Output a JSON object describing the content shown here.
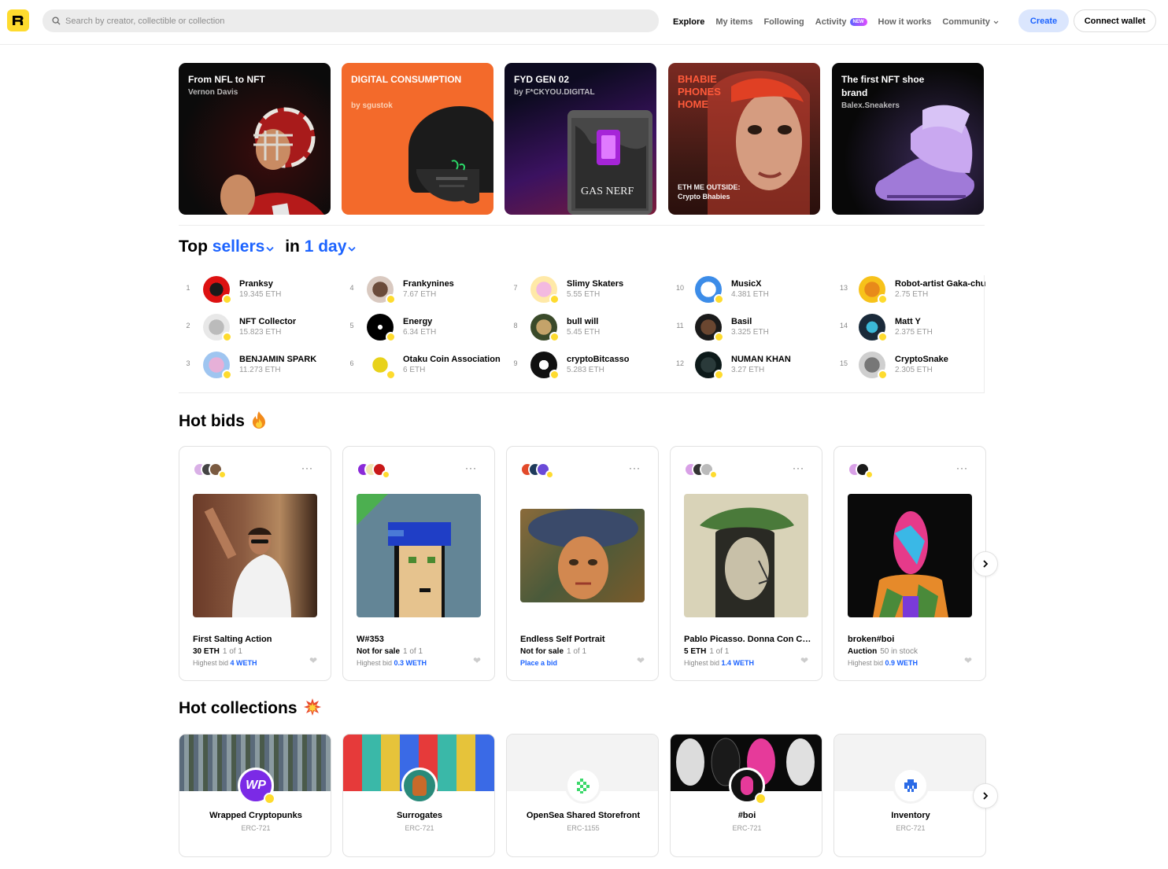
{
  "header": {
    "search_placeholder": "Search by creator, collectible or collection",
    "nav": [
      "Explore",
      "My items",
      "Following",
      "Activity",
      "How it works",
      "Community"
    ],
    "new_badge": "NEW",
    "create_label": "Create",
    "wallet_label": "Connect wallet"
  },
  "promos": [
    {
      "title": "From NFL to NFT",
      "subtitle": "Vernon Davis"
    },
    {
      "title": "DIGITAL CONSUMPTION",
      "subtitle": "by sgustok"
    },
    {
      "title": "FYD GEN 02",
      "subtitle": "by F*CKYOU.DIGITAL"
    },
    {
      "title": "BHABIE PHONES HOME",
      "subtitle": "ETH ME OUTSIDE: Crypto Bhabies"
    },
    {
      "title": "The first NFT shoe brand",
      "subtitle": "Balex.Sneakers"
    }
  ],
  "top_sellers": {
    "word_top": "Top",
    "word_sellers": "sellers",
    "word_in": "in",
    "word_day": "1 day",
    "list": [
      {
        "rank": "1",
        "name": "Pranksy",
        "eth": "19.345 ETH"
      },
      {
        "rank": "2",
        "name": "NFT Collector",
        "eth": "15.823 ETH"
      },
      {
        "rank": "3",
        "name": "BENJAMIN SPARK",
        "eth": "11.273 ETH"
      },
      {
        "rank": "4",
        "name": "Frankynines",
        "eth": "7.67 ETH"
      },
      {
        "rank": "5",
        "name": "Energy",
        "eth": "6.34 ETH"
      },
      {
        "rank": "6",
        "name": "Otaku Coin Association",
        "eth": "6 ETH"
      },
      {
        "rank": "7",
        "name": "Slimy Skaters",
        "eth": "5.55 ETH"
      },
      {
        "rank": "8",
        "name": "bull will",
        "eth": "5.45 ETH"
      },
      {
        "rank": "9",
        "name": "cryptoBitcasso",
        "eth": "5.283 ETH"
      },
      {
        "rank": "10",
        "name": "MusicX",
        "eth": "4.381 ETH"
      },
      {
        "rank": "11",
        "name": "Basil",
        "eth": "3.325 ETH"
      },
      {
        "rank": "12",
        "name": "NUMAN KHAN",
        "eth": "3.27 ETH"
      },
      {
        "rank": "13",
        "name": "Robot-artist Gaka-chu",
        "eth": "2.75 ETH"
      },
      {
        "rank": "14",
        "name": "Matt Y",
        "eth": "2.375 ETH"
      },
      {
        "rank": "15",
        "name": "CryptoSnake",
        "eth": "2.305 ETH"
      }
    ]
  },
  "hot_bids": {
    "title": "Hot bids",
    "items": [
      {
        "title": "First Salting Action",
        "price": "30 ETH",
        "edition": "1 of 1",
        "bid_label": "Highest bid",
        "bid": "4 WETH"
      },
      {
        "title": "W#353",
        "price": "Not for sale",
        "edition": "1 of 1",
        "bid_label": "Highest bid",
        "bid": "0.3 WETH"
      },
      {
        "title": "Endless Self Portrait",
        "price": "Not for sale",
        "edition": "1 of 1",
        "bid_label": "",
        "bid": "Place a bid"
      },
      {
        "title": "Pablo Picasso. Donna Con Cappello",
        "price": "5 ETH",
        "edition": "1 of 1",
        "bid_label": "Highest bid",
        "bid": "1.4 WETH"
      },
      {
        "title": "broken#boi",
        "price": "Auction",
        "edition": "50 in stock",
        "bid_label": "Highest bid",
        "bid": "0.9 WETH"
      }
    ]
  },
  "hot_collections": {
    "title": "Hot collections",
    "items": [
      {
        "name": "Wrapped Cryptopunks",
        "type": "ERC-721",
        "avatar_text": "WP"
      },
      {
        "name": "Surrogates",
        "type": "ERC-721"
      },
      {
        "name": "OpenSea Shared Storefront",
        "type": "ERC-1155"
      },
      {
        "name": "#boi",
        "type": "ERC-721"
      },
      {
        "name": "Inventory",
        "type": "ERC-721"
      }
    ]
  },
  "colors": {
    "accent": "#1c63ff",
    "brand": "#fedb2e"
  }
}
